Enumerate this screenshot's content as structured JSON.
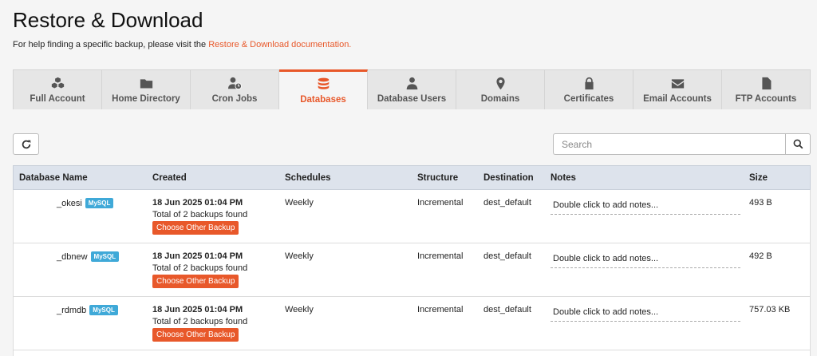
{
  "header": {
    "title": "Restore & Download",
    "help_prefix": "For help finding a specific backup, please visit the ",
    "help_link": "Restore & Download documentation."
  },
  "tabs": [
    {
      "label": "Full Account",
      "icon": "cubes-icon"
    },
    {
      "label": "Home Directory",
      "icon": "folder-icon"
    },
    {
      "label": "Cron Jobs",
      "icon": "user-clock-icon"
    },
    {
      "label": "Databases",
      "icon": "database-icon",
      "active": true
    },
    {
      "label": "Database Users",
      "icon": "user-tie-icon"
    },
    {
      "label": "Domains",
      "icon": "map-marker-icon"
    },
    {
      "label": "Certificates",
      "icon": "lock-icon"
    },
    {
      "label": "Email Accounts",
      "icon": "envelope-icon"
    },
    {
      "label": "FTP Accounts",
      "icon": "file-icon"
    }
  ],
  "search": {
    "placeholder": "Search",
    "value": ""
  },
  "table": {
    "headers": {
      "name": "Database Name",
      "created": "Created",
      "schedules": "Schedules",
      "structure": "Structure",
      "destination": "Destination",
      "notes": "Notes",
      "size": "Size"
    },
    "rows": [
      {
        "name": "_okesi",
        "badge": "MySQL",
        "date": "18 Jun 2025 01:04 PM",
        "count": "Total of 2 backups found",
        "button": "Choose Other Backup",
        "schedule": "Weekly",
        "structure": "Incremental",
        "destination": "dest_default",
        "notes": "Double click to add notes...",
        "size": "493 B"
      },
      {
        "name": "_dbnew",
        "badge": "MySQL",
        "date": "18 Jun 2025 01:04 PM",
        "count": "Total of 2 backups found",
        "button": "Choose Other Backup",
        "schedule": "Weekly",
        "structure": "Incremental",
        "destination": "dest_default",
        "notes": "Double click to add notes...",
        "size": "492 B"
      },
      {
        "name": "_rdmdb",
        "badge": "MySQL",
        "date": "18 Jun 2025 01:04 PM",
        "count": "Total of 2 backups found",
        "button": "Choose Other Backup",
        "schedule": "Weekly",
        "structure": "Incremental",
        "destination": "dest_default",
        "notes": "Double click to add notes...",
        "size": "757.03 KB"
      }
    ]
  },
  "colors": {
    "accent": "#e8582a",
    "badge": "#3fa9d8",
    "header_bg": "#dde3ec"
  }
}
